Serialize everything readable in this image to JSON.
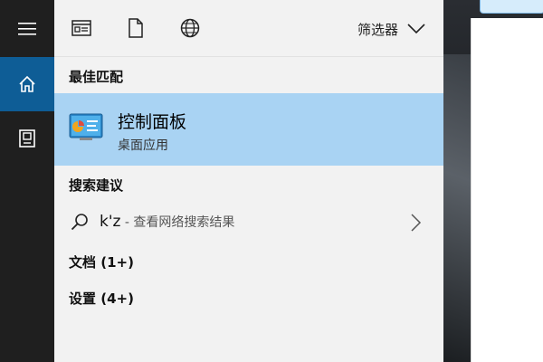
{
  "rail": {
    "items": [
      {
        "name": "menu",
        "icon": "hamburger-menu-icon"
      },
      {
        "name": "home",
        "icon": "home-icon",
        "active": true
      },
      {
        "name": "notebook",
        "icon": "notebook-icon"
      }
    ]
  },
  "toolbar": {
    "icons": [
      "apps-icon",
      "documents-icon",
      "web-icon"
    ],
    "filter_label": "筛选器",
    "filter_icon": "chevron-down-icon"
  },
  "best_match": {
    "header": "最佳匹配",
    "app_name": "控制面板",
    "app_type": "桌面应用",
    "icon": "control-panel-icon"
  },
  "suggestions": {
    "header": "搜索建议",
    "query": "k'z",
    "hint": " - 查看网络搜索结果"
  },
  "documents_header": "文档 (1+)",
  "settings_header": "设置 (4+)",
  "colors": {
    "accent": "#0e5d96",
    "highlight": "#a9d3f3",
    "panel_bg": "#f2f2f2",
    "rail_bg": "#1f1f1f"
  }
}
